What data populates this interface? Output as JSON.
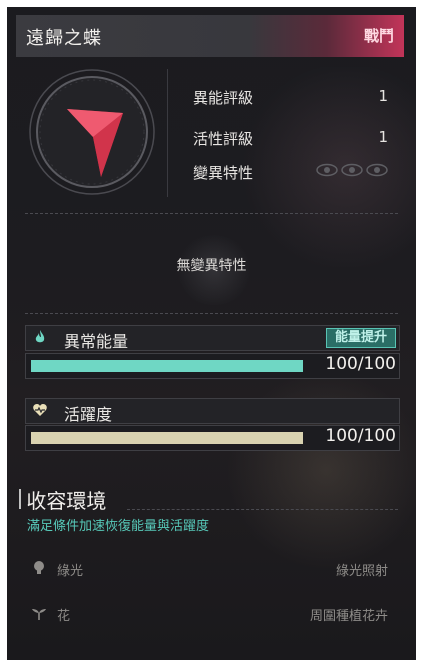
{
  "header": {
    "title": "遠歸之蝶",
    "tag": "戰鬥"
  },
  "stats": [
    {
      "label": "異能評級",
      "value": "1"
    },
    {
      "label": "活性評級",
      "value": "1"
    },
    {
      "label": "變異特性",
      "value": ""
    }
  ],
  "trait_text": "無變異特性",
  "energy": {
    "label": "異常能量",
    "button": "能量提升",
    "value": "100/100",
    "fraction": 1.0,
    "color": "#6fd7c4"
  },
  "vitality": {
    "label": "活躍度",
    "value": "100/100",
    "fraction": 1.0,
    "color": "#d8d2b0"
  },
  "containment": {
    "title": "收容環境",
    "subtitle": "滿足條件加速恢復能量與活躍度",
    "conditions": [
      {
        "name": "綠光",
        "requirement": "綠光照射",
        "icon": "bulb-icon"
      },
      {
        "name": "花",
        "requirement": "周圍種植花卉",
        "icon": "sprout-icon"
      }
    ]
  },
  "colors": {
    "accent_teal": "#57c9b9",
    "accent_pink": "#c23459",
    "emblem_red": "#c8283f"
  }
}
